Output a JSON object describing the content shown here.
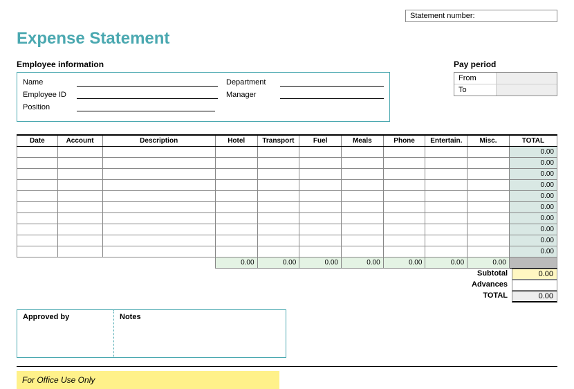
{
  "statement_number_label": "Statement number:",
  "title": "Expense Statement",
  "employee_info": {
    "header": "Employee information",
    "name_label": "Name",
    "employee_id_label": "Employee ID",
    "position_label": "Position",
    "department_label": "Department",
    "manager_label": "Manager"
  },
  "pay_period": {
    "header": "Pay period",
    "from_label": "From",
    "to_label": "To",
    "from_value": "",
    "to_value": ""
  },
  "columns": {
    "date": "Date",
    "account": "Account",
    "description": "Description",
    "hotel": "Hotel",
    "transport": "Transport",
    "fuel": "Fuel",
    "meals": "Meals",
    "phone": "Phone",
    "entertain": "Entertain.",
    "misc": "Misc.",
    "total": "TOTAL"
  },
  "rows": [
    {
      "total": "0.00"
    },
    {
      "total": "0.00"
    },
    {
      "total": "0.00"
    },
    {
      "total": "0.00"
    },
    {
      "total": "0.00"
    },
    {
      "total": "0.00"
    },
    {
      "total": "0.00"
    },
    {
      "total": "0.00"
    },
    {
      "total": "0.00"
    },
    {
      "total": "0.00"
    }
  ],
  "column_sums": {
    "hotel": "0.00",
    "transport": "0.00",
    "fuel": "0.00",
    "meals": "0.00",
    "phone": "0.00",
    "entertain": "0.00",
    "misc": "0.00"
  },
  "totals": {
    "subtotal_label": "Subtotal",
    "subtotal_value": "0.00",
    "advances_label": "Advances",
    "advances_value": "",
    "total_label": "TOTAL",
    "total_value": "0.00"
  },
  "approved_by_label": "Approved by",
  "notes_label": "Notes",
  "office_use": "For Office Use Only"
}
